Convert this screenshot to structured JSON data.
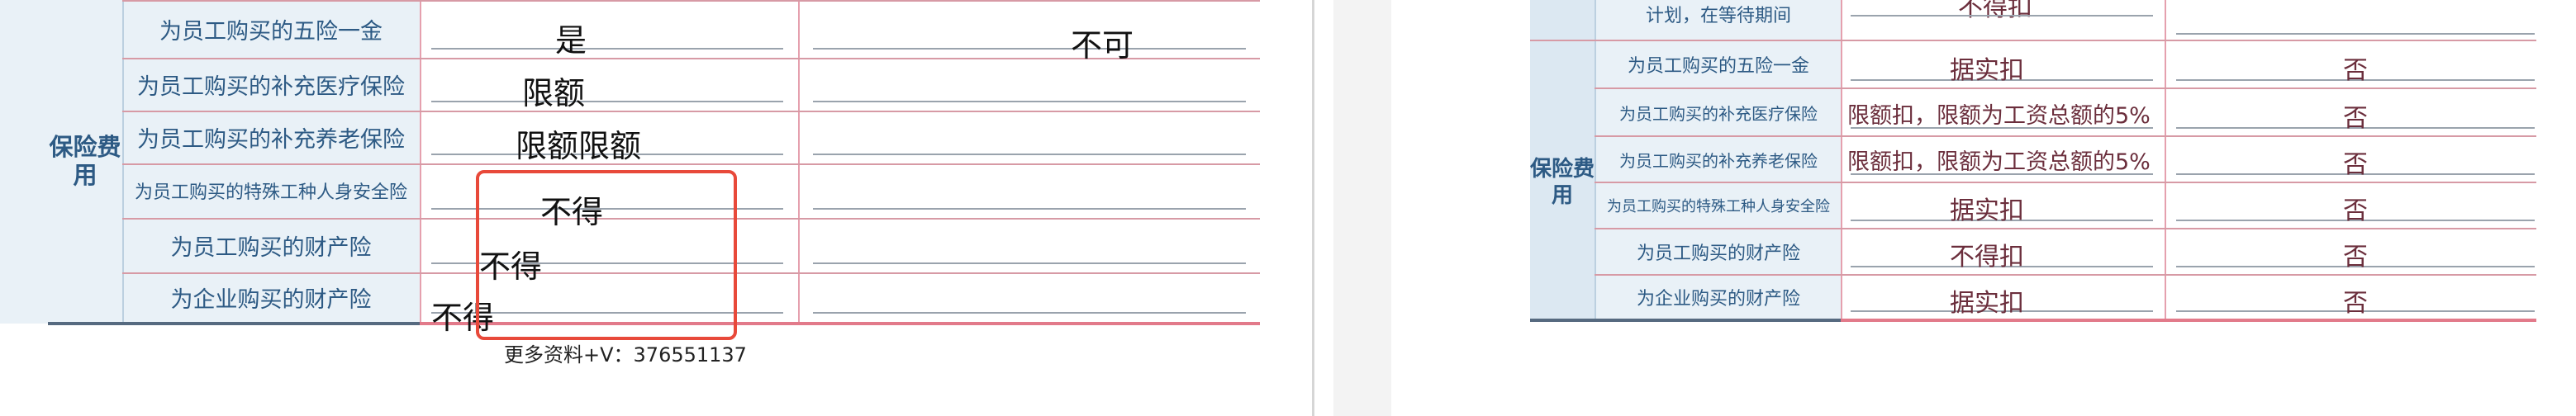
{
  "left_panel": {
    "category": "保险费用",
    "rows": [
      {
        "label": "为员工购买的五险一金",
        "answer": "是",
        "note": "不可"
      },
      {
        "label": "为员工购买的补充医疗保险",
        "answer": "限额"
      },
      {
        "label": "为员工购买的补充养老保险",
        "answer": "限额限额"
      },
      {
        "label": "为员工购买的特殊工种人身安全险",
        "answer": "不得"
      },
      {
        "label": "为员工购买的财产险",
        "answer": "不得"
      },
      {
        "label": "为企业购买的财产险",
        "answer": "不得"
      }
    ],
    "footer_note": "更多资料+V：376551137"
  },
  "right_panel": {
    "top_partial": {
      "label": "计划，在等待期间",
      "deduct": "不得扣"
    },
    "category": "保险费用",
    "rows": [
      {
        "label": "为员工购买的五险一金",
        "deduct": "据实扣",
        "adjust": "否"
      },
      {
        "label": "为员工购买的补充医疗保险",
        "deduct": "限额扣，限额为工资总额的5%",
        "adjust": "否"
      },
      {
        "label": "为员工购买的补充养老保险",
        "deduct": "限额扣，限额为工资总额的5%",
        "adjust": "否"
      },
      {
        "label": "为员工购买的特殊工种人身安全险",
        "deduct": "据实扣",
        "adjust": "否"
      },
      {
        "label": "为员工购买的财产险",
        "deduct": "不得扣",
        "adjust": "否"
      },
      {
        "label": "为企业购买的财产险",
        "deduct": "据实扣",
        "adjust": "否"
      }
    ]
  },
  "colors": {
    "highlight_box": "#e8493a",
    "table_border": "#d79aa5",
    "label_bg": "#e9f1f7",
    "label_text": "#2d5a84"
  }
}
